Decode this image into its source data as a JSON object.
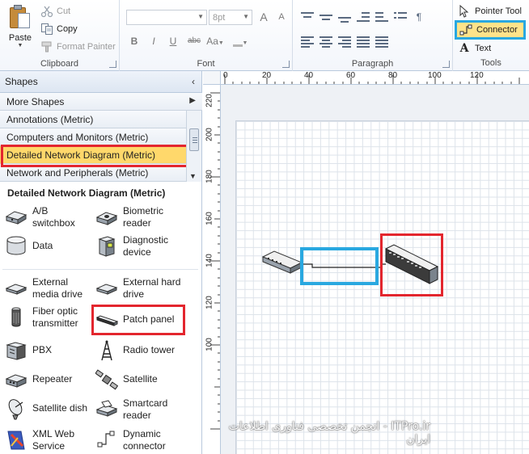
{
  "ribbon": {
    "clipboard": {
      "paste": "Paste",
      "cut": "Cut",
      "copy": "Copy",
      "format_painter": "Format Painter",
      "group_label": "Clipboard"
    },
    "font": {
      "font_name_value": "",
      "font_size_value": "8pt",
      "bold": "B",
      "italic": "I",
      "underline": "U",
      "strikethrough": "abc",
      "change_case": "Aa",
      "grow_font": "A",
      "shrink_font": "A",
      "group_label": "Font"
    },
    "paragraph": {
      "paragraph_mark": "¶",
      "group_label": "Paragraph"
    },
    "tools": {
      "pointer_tool": "Pointer Tool",
      "connector": "Connector",
      "text": "Text",
      "text_icon": "A",
      "group_label": "Tools"
    }
  },
  "shapes_pane": {
    "header": "Shapes",
    "collapse_glyph": "‹",
    "more_shapes": "More Shapes",
    "stencils": [
      {
        "label": "Annotations (Metric)"
      },
      {
        "label": "Computers and Monitors (Metric)"
      },
      {
        "label": "Detailed Network Diagram (Metric)"
      },
      {
        "label": "Network and Peripherals (Metric)"
      }
    ],
    "open_stencil_title": "Detailed Network Diagram (Metric)",
    "shapes": [
      {
        "label": "A/B switchbox",
        "icon": "switchbox-icon"
      },
      {
        "label": "Biometric reader",
        "icon": "biometric-reader-icon"
      },
      {
        "label": "Data",
        "icon": "database-icon"
      },
      {
        "label": "Diagnostic device",
        "icon": "diagnostic-device-icon"
      },
      {
        "label": "External media drive",
        "icon": "media-drive-icon"
      },
      {
        "label": "External hard drive",
        "icon": "hard-drive-icon"
      },
      {
        "label": "Fiber optic transmitter",
        "icon": "fiber-optic-icon"
      },
      {
        "label": "Patch panel",
        "icon": "patch-panel-icon"
      },
      {
        "label": "PBX",
        "icon": "pbx-icon"
      },
      {
        "label": "Radio tower",
        "icon": "radio-tower-icon"
      },
      {
        "label": "Repeater",
        "icon": "repeater-icon"
      },
      {
        "label": "Satellite",
        "icon": "satellite-icon"
      },
      {
        "label": "Satellite dish",
        "icon": "satellite-dish-icon"
      },
      {
        "label": "Smartcard reader",
        "icon": "smartcard-reader-icon"
      },
      {
        "label": "XML Web Service",
        "icon": "xml-web-service-icon"
      },
      {
        "label": "Dynamic connector",
        "icon": "dynamic-connector-icon"
      }
    ]
  },
  "rulers": {
    "horizontal": [
      "0",
      "20",
      "40",
      "60",
      "80",
      "100",
      "120"
    ],
    "vertical": [
      "220",
      "200",
      "180",
      "160",
      "140",
      "120",
      "100"
    ]
  },
  "watermark": "ITPro.ir - انجمن تخصصی فناوری اطلاعات ایران",
  "colors": {
    "highlight_red": "#e3262e",
    "highlight_blue": "#29a8e0",
    "selection_yellow": "#ffd86b"
  }
}
